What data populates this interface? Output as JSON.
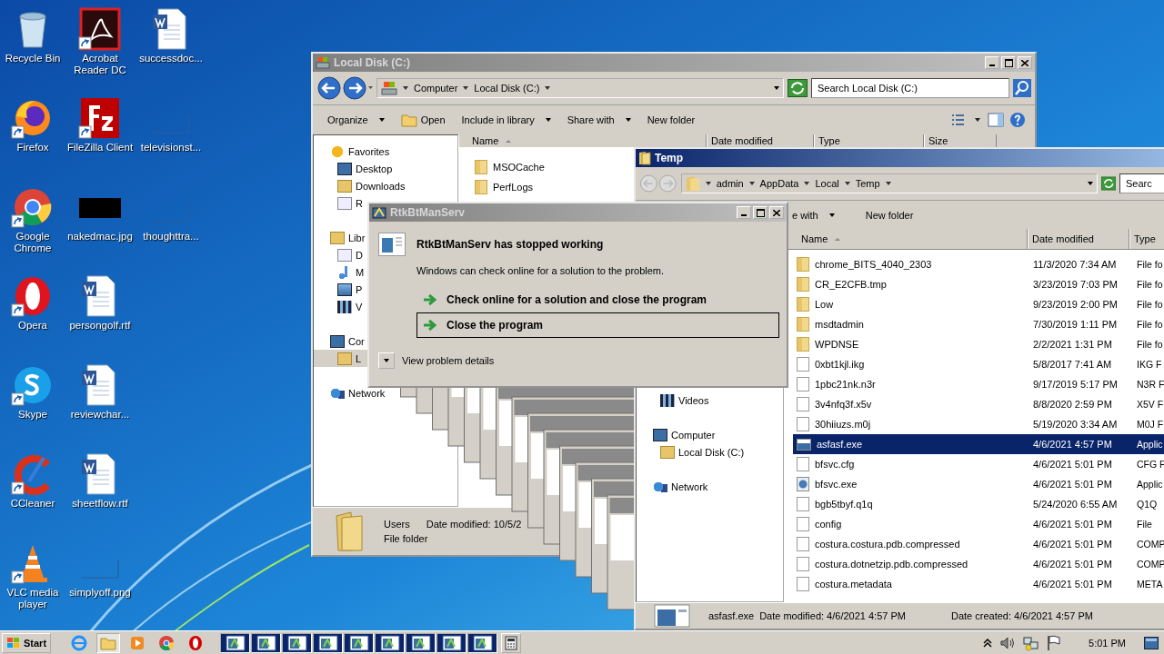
{
  "desktop_icons": [
    {
      "label": "Recycle Bin",
      "kind": "recycle",
      "shortcut": false
    },
    {
      "label": "Firefox",
      "kind": "firefox",
      "shortcut": true
    },
    {
      "label": "Google Chrome",
      "kind": "chrome",
      "shortcut": true
    },
    {
      "label": "Opera",
      "kind": "opera",
      "shortcut": true
    },
    {
      "label": "Skype",
      "kind": "skype",
      "shortcut": true
    },
    {
      "label": "CCleaner",
      "kind": "ccleaner",
      "shortcut": true
    },
    {
      "label": "VLC media player",
      "kind": "vlc",
      "shortcut": true
    },
    {
      "label": "Acrobat Reader DC",
      "kind": "acrobat",
      "shortcut": true
    },
    {
      "label": "FileZilla Client",
      "kind": "filezilla",
      "shortcut": true
    },
    {
      "label": "nakedmac.jpg",
      "kind": "black-thumb",
      "shortcut": false
    },
    {
      "label": "persongolf.rtf",
      "kind": "word",
      "shortcut": false
    },
    {
      "label": "reviewchar...",
      "kind": "word",
      "shortcut": false
    },
    {
      "label": "sheetflow.rtf",
      "kind": "word",
      "shortcut": false
    },
    {
      "label": "simplyoff.png",
      "kind": "blank-thumb",
      "shortcut": false
    },
    {
      "label": "successdoc...",
      "kind": "word",
      "shortcut": false
    },
    {
      "label": "televisionst...",
      "kind": "blank-thumb",
      "shortcut": false
    },
    {
      "label": "thoughttra...",
      "kind": "blank-thumb",
      "shortcut": false
    }
  ],
  "local_disk_window": {
    "title": "Local Disk (C:)",
    "active": false,
    "breadcrumb": [
      "Computer",
      "Local Disk (C:)"
    ],
    "search": {
      "placeholder": "Search Local Disk (C:)"
    },
    "toolbar": [
      {
        "label": "Organize",
        "kind": "menu"
      },
      {
        "label": "Open",
        "kind": "open"
      },
      {
        "label": "Include in library",
        "kind": "menu"
      },
      {
        "label": "Share with",
        "kind": "menu"
      },
      {
        "label": "New folder",
        "kind": "plain"
      }
    ],
    "nav": [
      {
        "label": "Favorites",
        "kind": "star",
        "selected": false,
        "children": [
          {
            "label": "Desktop",
            "kind": "desktop",
            "selected": false
          },
          {
            "label": "Downloads",
            "kind": "downloads",
            "selected": false
          },
          {
            "label": "R",
            "kind": "recent",
            "selected": false
          }
        ]
      },
      {
        "label": "Libr",
        "kind": "library",
        "selected": false,
        "children": [
          {
            "label": "D",
            "kind": "document",
            "selected": false
          },
          {
            "label": "M",
            "kind": "music",
            "selected": false
          },
          {
            "label": "P",
            "kind": "pictures",
            "selected": false
          },
          {
            "label": "V",
            "kind": "video",
            "selected": false
          }
        ]
      },
      {
        "label": "Cor",
        "kind": "computer",
        "selected": false,
        "children": [
          {
            "label": "L",
            "kind": "disk",
            "selected": true
          }
        ]
      },
      {
        "label": "Network",
        "kind": "network",
        "selected": false
      }
    ],
    "columns": [
      "Name",
      "Date modified",
      "Type",
      "Size"
    ],
    "rows": [
      {
        "name": "MSOCache",
        "kind": "folder"
      },
      {
        "name": "PerfLogs",
        "kind": "folder"
      }
    ],
    "details": {
      "name": "Users",
      "modified": "Date modified: 10/5/2",
      "type": "File folder"
    }
  },
  "temp_window": {
    "title": "Temp",
    "active": true,
    "breadcrumb": [
      "admin",
      "AppData",
      "Local",
      "Temp"
    ],
    "search": {
      "placeholder": "Searc"
    },
    "toolbar": [
      {
        "label": "e with",
        "kind": "menu"
      },
      {
        "label": "New folder",
        "kind": "plain"
      }
    ],
    "nav": [
      {
        "label": "Videos",
        "kind": "video",
        "selected": false
      },
      {
        "label": "Computer",
        "kind": "computer",
        "selected": false,
        "children": [
          {
            "label": "Local Disk (C:)",
            "kind": "disk",
            "selected": false
          }
        ]
      },
      {
        "label": "Network",
        "kind": "network",
        "selected": false
      }
    ],
    "columns": [
      "Name",
      "Date modified",
      "Type"
    ],
    "rows": [
      {
        "name": "chrome_BITS_4040_2303",
        "modified": "11/3/2020 7:34 AM",
        "type": "File fo",
        "kind": "folder",
        "selected": false
      },
      {
        "name": "CR_E2CFB.tmp",
        "modified": "3/23/2019 7:03 PM",
        "type": "File fo",
        "kind": "folder",
        "selected": false
      },
      {
        "name": "Low",
        "modified": "9/23/2019 2:00 PM",
        "type": "File fo",
        "kind": "folder",
        "selected": false
      },
      {
        "name": "msdtadmin",
        "modified": "7/30/2019 1:11 PM",
        "type": "File fo",
        "kind": "folder",
        "selected": false
      },
      {
        "name": "WPDNSE",
        "modified": "2/2/2021 1:31 PM",
        "type": "File fo",
        "kind": "folder",
        "selected": false
      },
      {
        "name": "0xbt1kjl.ikg",
        "modified": "5/8/2017 7:41 AM",
        "type": "IKG F",
        "kind": "file",
        "selected": false
      },
      {
        "name": "1pbc21nk.n3r",
        "modified": "9/17/2019 5:17 PM",
        "type": "N3R F",
        "kind": "file",
        "selected": false
      },
      {
        "name": "3v4nfq3f.x5v",
        "modified": "8/8/2020 2:59 PM",
        "type": "X5V F",
        "kind": "file",
        "selected": false
      },
      {
        "name": "30hiiuzs.m0j",
        "modified": "5/19/2020 3:34 AM",
        "type": "M0J F",
        "kind": "file",
        "selected": false
      },
      {
        "name": "asfasf.exe",
        "modified": "4/6/2021 4:57 PM",
        "type": "Applic",
        "kind": "exe",
        "selected": true
      },
      {
        "name": "bfsvc.cfg",
        "modified": "4/6/2021 5:01 PM",
        "type": "CFG F",
        "kind": "file",
        "selected": false
      },
      {
        "name": "bfsvc.exe",
        "modified": "4/6/2021 5:01 PM",
        "type": "Applic",
        "kind": "app",
        "selected": false
      },
      {
        "name": "bgb5tbyf.q1q",
        "modified": "5/24/2020 6:55 AM",
        "type": "Q1Q",
        "kind": "file",
        "selected": false
      },
      {
        "name": "config",
        "modified": "4/6/2021 5:01 PM",
        "type": "File",
        "kind": "file",
        "selected": false
      },
      {
        "name": "costura.costura.pdb.compressed",
        "modified": "4/6/2021 5:01 PM",
        "type": "COMP",
        "kind": "file",
        "selected": false
      },
      {
        "name": "costura.dotnetzip.pdb.compressed",
        "modified": "4/6/2021 5:01 PM",
        "type": "COMP",
        "kind": "file",
        "selected": false
      },
      {
        "name": "costura.metadata",
        "modified": "4/6/2021 5:01 PM",
        "type": "META",
        "kind": "file",
        "selected": false
      }
    ],
    "details": {
      "name": "asfasf.exe",
      "modified": "Date modified: 4/6/2021 4:57 PM",
      "created": "Date created: 4/6/2021 4:57 PM"
    }
  },
  "error_dialog": {
    "title": "RtkBtManServ",
    "heading": "RtkBtManServ has stopped working",
    "message": "Windows can check online for a solution to the problem.",
    "options": [
      {
        "label": "Check online for a solution and close the program",
        "selected": false
      },
      {
        "label": "Close the program",
        "selected": true
      }
    ],
    "details_toggle": "View problem details"
  },
  "taskbar": {
    "start": "Start",
    "quick_launch": [
      {
        "kind": "ie",
        "selected": false
      },
      {
        "kind": "explorer",
        "selected": true
      },
      {
        "kind": "media",
        "selected": false
      },
      {
        "kind": "chrome",
        "selected": false
      },
      {
        "kind": "opera",
        "selected": false
      }
    ],
    "clock": "5:01 PM"
  }
}
